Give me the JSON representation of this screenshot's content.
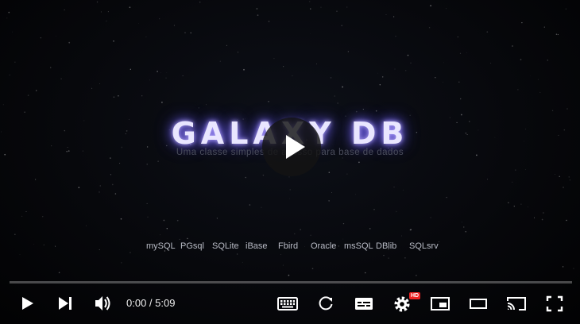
{
  "video": {
    "title_graphic": "GALAXY DB",
    "subtitle_graphic": "Uma classe simples de acesso para base de dados",
    "databases": [
      "mySQL",
      "PGsql",
      "SQLite",
      "iBase",
      "Fbird",
      "Oracle",
      "msSQL",
      "DBlib",
      "SQLsrv"
    ]
  },
  "player": {
    "time_display": "0:00 / 5:09",
    "progress_fraction": 0,
    "hd_badge": "HD"
  },
  "icons": {
    "big_play": "play-icon",
    "play": "play-icon",
    "next": "skip-next-icon",
    "volume": "volume-icon",
    "keyboard": "keyboard-icon",
    "autoplay": "autoplay-icon",
    "subtitles": "subtitles-icon",
    "settings": "settings-icon",
    "miniplayer": "miniplayer-icon",
    "theater": "theater-mode-icon",
    "cast": "cast-icon",
    "fullscreen": "fullscreen-icon"
  },
  "colors": {
    "progress_played": "#ff0000",
    "hd_badge": "#e22222",
    "logo_glow": "#7b6cff"
  }
}
